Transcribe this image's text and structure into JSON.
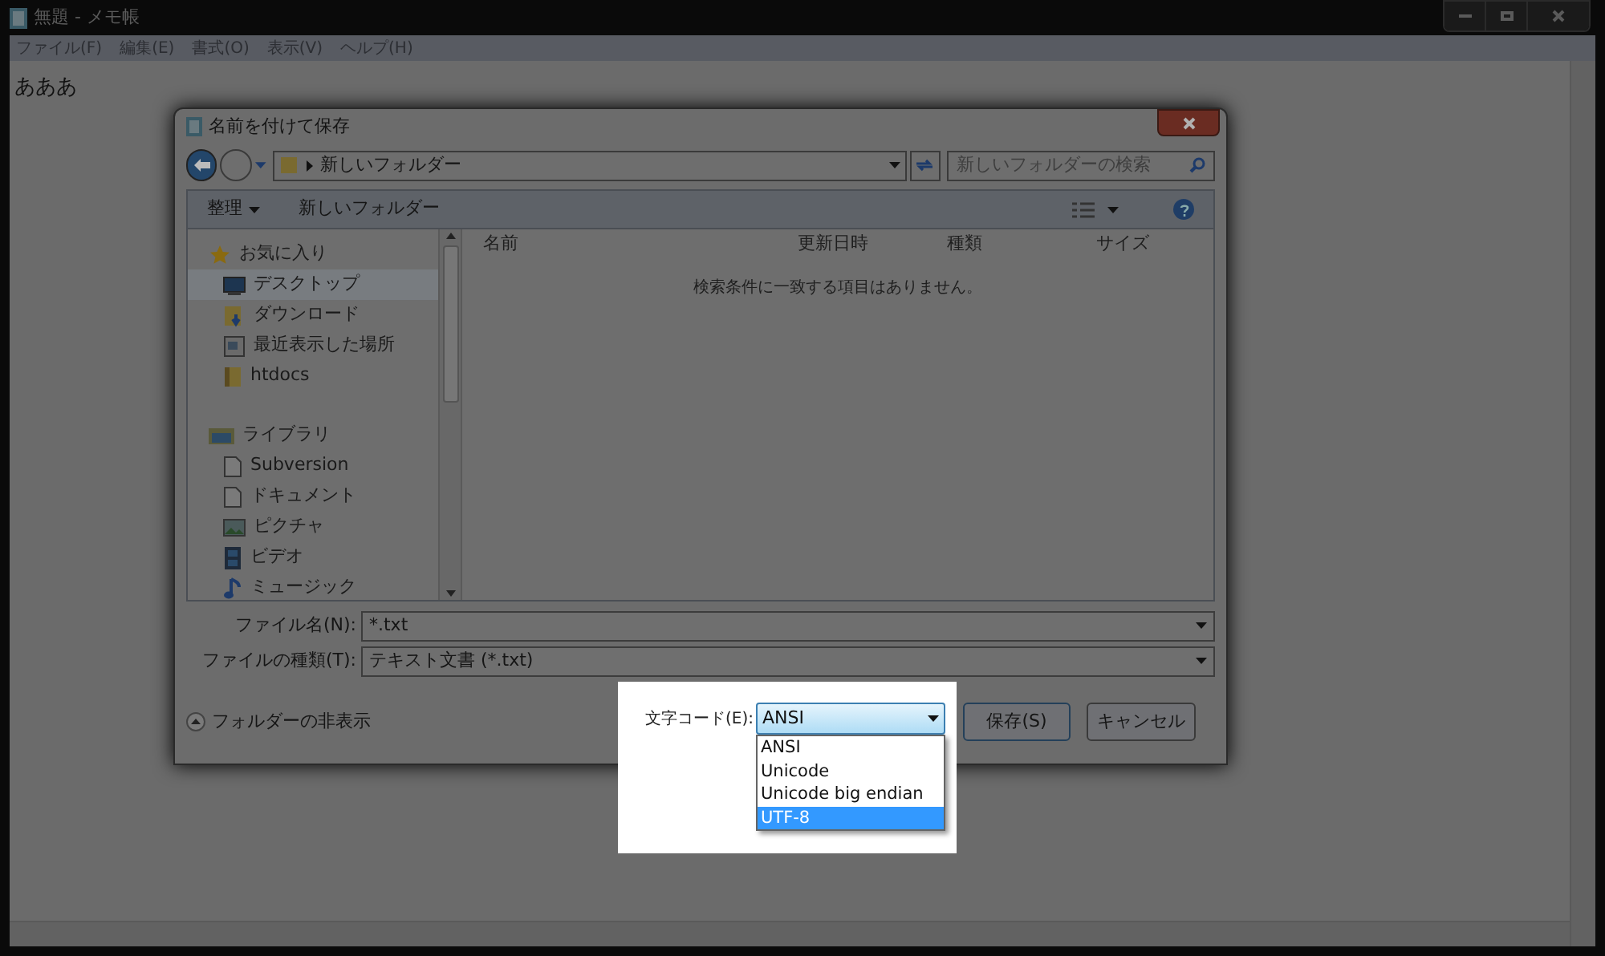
{
  "notepad": {
    "title": "無題 - メモ帳",
    "menu": [
      "ファイル(F)",
      "編集(E)",
      "書式(O)",
      "表示(V)",
      "ヘルプ(H)"
    ],
    "content": "あああ"
  },
  "dialog": {
    "title": "名前を付けて保存",
    "address": "新しいフォルダー",
    "search_placeholder": "新しいフォルダーの検索",
    "toolbar": {
      "organize": "整理",
      "new_folder": "新しいフォルダー"
    },
    "nav": [
      {
        "label": "お気に入り",
        "kind": "star",
        "selected": false,
        "children": [
          {
            "label": "デスクトップ",
            "kind": "desktop",
            "selected": true
          },
          {
            "label": "ダウンロード",
            "kind": "download",
            "selected": false
          },
          {
            "label": "最近表示した場所",
            "kind": "recent",
            "selected": false
          },
          {
            "label": "htdocs",
            "kind": "folder",
            "selected": false
          }
        ]
      },
      {
        "label": "ライブラリ",
        "kind": "library",
        "selected": false,
        "children": [
          {
            "label": "Subversion",
            "kind": "document",
            "selected": false
          },
          {
            "label": "ドキュメント",
            "kind": "document",
            "selected": false
          },
          {
            "label": "ピクチャ",
            "kind": "picture",
            "selected": false
          },
          {
            "label": "ビデオ",
            "kind": "video",
            "selected": false
          },
          {
            "label": "ミュージック",
            "kind": "music",
            "selected": false
          }
        ]
      }
    ],
    "columns": [
      "名前",
      "更新日時",
      "種類",
      "サイズ"
    ],
    "empty_message": "検索条件に一致する項目はありません。",
    "file_name": {
      "label": "ファイル名(N):",
      "value": "*.txt"
    },
    "file_type": {
      "label": "ファイルの種類(T):",
      "value": "テキスト文書 (*.txt)"
    },
    "hide_folders": "フォルダーの非表示",
    "encoding": {
      "label": "文字コード(E):",
      "value": "ANSI",
      "options": [
        {
          "label": "ANSI",
          "highlighted": false
        },
        {
          "label": "Unicode",
          "highlighted": false
        },
        {
          "label": "Unicode big endian",
          "highlighted": false
        },
        {
          "label": "UTF-8",
          "highlighted": true
        }
      ]
    },
    "buttons": {
      "save": "保存(S)",
      "cancel": "キャンセル"
    }
  }
}
